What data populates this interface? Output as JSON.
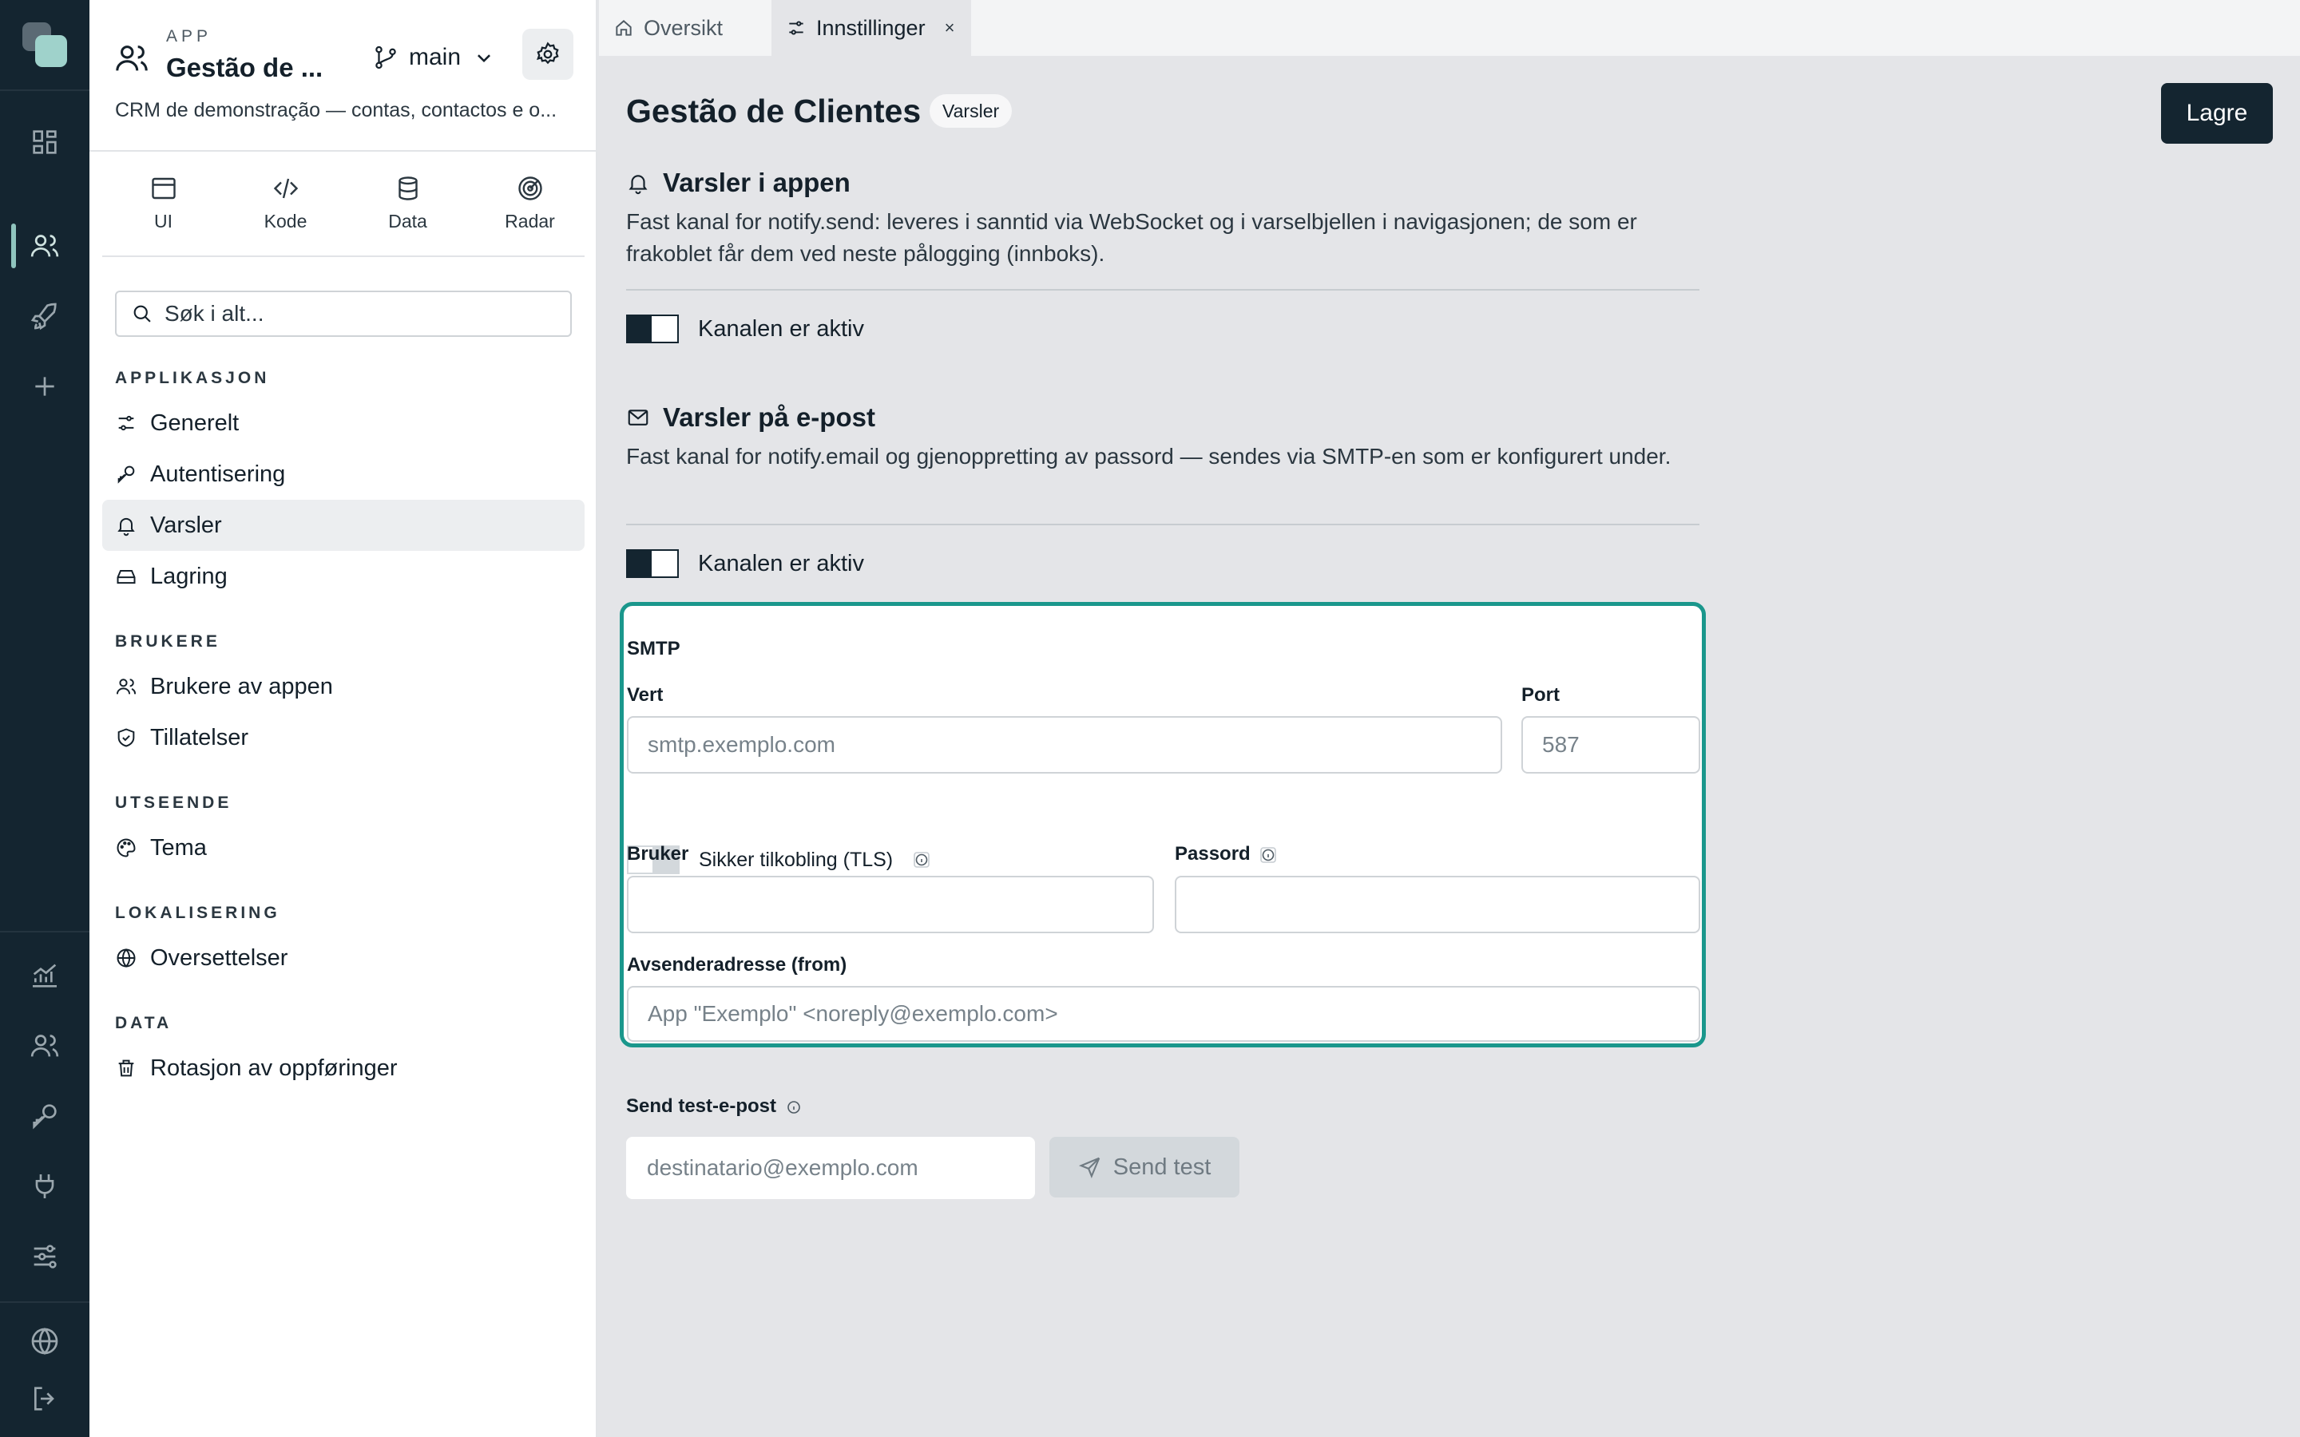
{
  "rail": {
    "icons": [
      "dashboard-icon",
      "users-icon",
      "rocket-icon",
      "plus-icon",
      "analytics-icon",
      "team-icon",
      "key-icon",
      "plug-icon",
      "sliders-icon",
      "globe-icon",
      "logout-icon"
    ],
    "active": "users-icon",
    "accent": "#8fc4bd"
  },
  "sidebar": {
    "app_kicker": "APP",
    "app_name": "Gestão de ...",
    "branch": "main",
    "description": "CRM de demonstração — contas, contactos e o...",
    "modes": [
      {
        "label": "UI",
        "icon": "window-icon"
      },
      {
        "label": "Kode",
        "icon": "code-icon"
      },
      {
        "label": "Data",
        "icon": "database-icon"
      },
      {
        "label": "Radar",
        "icon": "radar-icon"
      }
    ],
    "search_placeholder": "Søk i alt...",
    "sections": [
      {
        "title": "APPLIKASJON",
        "items": [
          {
            "label": "Generelt",
            "icon": "sliders-icon"
          },
          {
            "label": "Autentisering",
            "icon": "key-icon"
          },
          {
            "label": "Varsler",
            "icon": "bell-icon",
            "active": true
          },
          {
            "label": "Lagring",
            "icon": "storage-icon"
          }
        ]
      },
      {
        "title": "BRUKERE",
        "items": [
          {
            "label": "Brukere av appen",
            "icon": "users-icon"
          },
          {
            "label": "Tillatelser",
            "icon": "shield-check-icon"
          }
        ]
      },
      {
        "title": "UTSEENDE",
        "items": [
          {
            "label": "Tema",
            "icon": "palette-icon"
          }
        ]
      },
      {
        "title": "LOKALISERING",
        "items": [
          {
            "label": "Oversettelser",
            "icon": "globe-icon"
          }
        ]
      },
      {
        "title": "DATA",
        "items": [
          {
            "label": "Rotasjon av oppføringer",
            "icon": "trash-icon"
          }
        ]
      }
    ]
  },
  "tabs": [
    {
      "label": "Oversikt",
      "icon": "home-icon"
    },
    {
      "label": "Innstillinger",
      "icon": "sliders-icon",
      "active": true,
      "close": "×"
    }
  ],
  "main": {
    "title": "Gestão de Clientes",
    "badge": "Varsler",
    "save_label": "Lagre",
    "in_app": {
      "title": "Varsler i appen",
      "description": "Fast kanal for notify.send: leveres i sanntid via WebSocket og i varselbjellen i navigasjonen; de som er frakoblet får dem ved neste pålogging (innboks).",
      "toggle_label": "Kanalen er aktiv",
      "enabled": true
    },
    "email": {
      "title": "Varsler på e-post",
      "description": "Fast kanal for notify.email og gjenoppretting av passord — sendes via SMTP-en som er konfigurert under.",
      "toggle_label": "Kanalen er aktiv",
      "enabled": true
    },
    "smtp": {
      "title": "SMTP",
      "host_label": "Vert",
      "host_placeholder": "smtp.exemplo.com",
      "port_label": "Port",
      "port_placeholder": "587",
      "tls_label": "Sikker tilkobling (TLS)",
      "tls_enabled": false,
      "user_label": "Bruker",
      "user_value": "",
      "password_label": "Passord",
      "password_value": "",
      "from_label": "Avsenderadresse (from)",
      "from_placeholder": "App \"Exemplo\" <noreply@exemplo.com>",
      "highlight_color": "#1a978c"
    },
    "test": {
      "label": "Send test-e-post",
      "placeholder": "destinatario@exemplo.com",
      "button_label": "Send test"
    }
  }
}
